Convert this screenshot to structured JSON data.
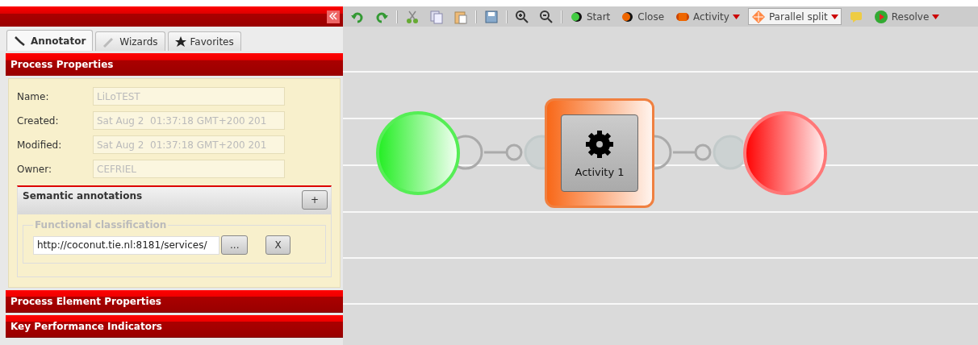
{
  "sidebar": {
    "tabs": [
      {
        "label": "Annotator",
        "selected": true
      },
      {
        "label": "Wizards",
        "selected": false
      },
      {
        "label": "Favorites",
        "selected": false
      }
    ],
    "sections": [
      {
        "title": "Process Properties",
        "expanded": true
      },
      {
        "title": "Process Element Properties",
        "expanded": false
      },
      {
        "title": "Key Performance Indicators",
        "expanded": false
      }
    ],
    "properties": [
      {
        "label": "Name:",
        "value": "LiLoTEST",
        "disabled": true
      },
      {
        "label": "Created:",
        "value": "Sat Aug 2  01:37:18 GMT+200 201",
        "disabled": true
      },
      {
        "label": "Modified:",
        "value": "Sat Aug 2  01:37:18 GMT+200 201",
        "disabled": true
      },
      {
        "label": "Owner:",
        "value": "CEFRIEL",
        "disabled": true
      }
    ],
    "semantic": {
      "title": "Semantic annotations",
      "add_button": "+",
      "group": "Functional classification",
      "value": "http://coconut.tie.nl:8181/services/",
      "browse_button": "...",
      "remove_button": "X"
    }
  },
  "toolbar": {
    "buttons": [
      {
        "label": "Start",
        "dropdown": false,
        "pressed": false
      },
      {
        "label": "Close",
        "dropdown": false,
        "pressed": false
      },
      {
        "label": "Activity",
        "dropdown": true,
        "pressed": false
      },
      {
        "label": "Parallel split",
        "dropdown": true,
        "pressed": true
      },
      {
        "label": "Resolve",
        "dropdown": true,
        "pressed": false
      }
    ]
  },
  "canvas": {
    "activity": {
      "label": "Activity 1"
    }
  }
}
